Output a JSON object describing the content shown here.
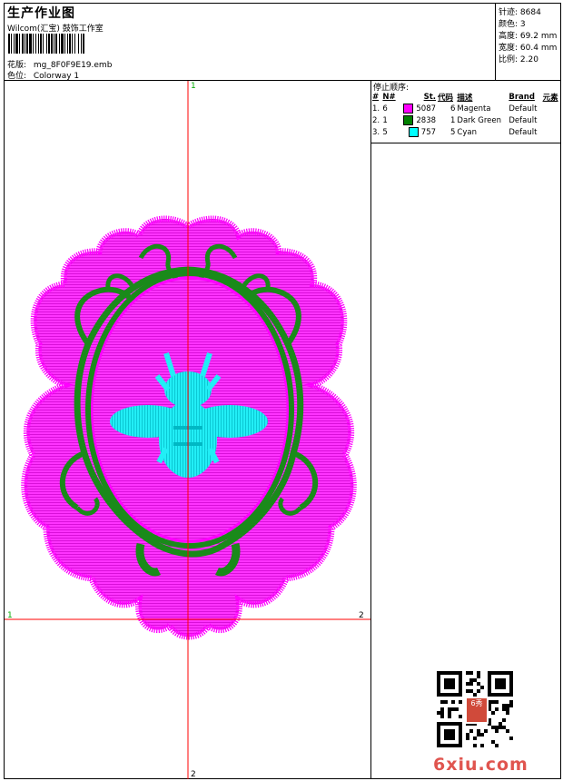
{
  "header": {
    "title": "生产作业图",
    "company": "Wilcom(汇宝) 鼓饰工作室",
    "design_label": "花版:",
    "design_value": "mg_8F0F9E19.emb",
    "colorway_label": "色位:",
    "colorway_value": "Colorway 1"
  },
  "stats": [
    {
      "label": "针迹:",
      "value": "8684"
    },
    {
      "label": "颜色:",
      "value": "3"
    },
    {
      "label": "高度:",
      "value": "69.2 mm"
    },
    {
      "label": "宽度:",
      "value": "60.4 mm"
    },
    {
      "label": "比例:",
      "value": "2.20"
    }
  ],
  "stop_sequence": {
    "title": "停止顺序:",
    "headers": [
      "#",
      "N#",
      "St.",
      "代码",
      "描述",
      "Brand",
      "元素"
    ],
    "rows": [
      {
        "num": "1.",
        "n": "6",
        "color": "#ff00ff",
        "stitches": "5087",
        "code": "6",
        "desc": "Magenta",
        "brand": "Default",
        "element": ""
      },
      {
        "num": "2.",
        "n": "1",
        "color": "#008000",
        "stitches": "2838",
        "code": "1",
        "desc": "Dark Green",
        "brand": "Default",
        "element": ""
      },
      {
        "num": "3.",
        "n": "5",
        "color": "#00ffff",
        "stitches": "757",
        "code": "5",
        "desc": "Cyan",
        "brand": "Default",
        "element": ""
      }
    ]
  },
  "axis_markers": {
    "top": "1",
    "left": "1",
    "right": "2",
    "bottom": "2"
  },
  "colors": {
    "magenta": "#ff00ff",
    "green": "#1a8a1a",
    "cyan": "#1ce6f0",
    "axis": "#ff0000"
  },
  "qr_stamp_text": "6秀",
  "watermark": {
    "main": "6xiu",
    "suffix": ".com"
  }
}
